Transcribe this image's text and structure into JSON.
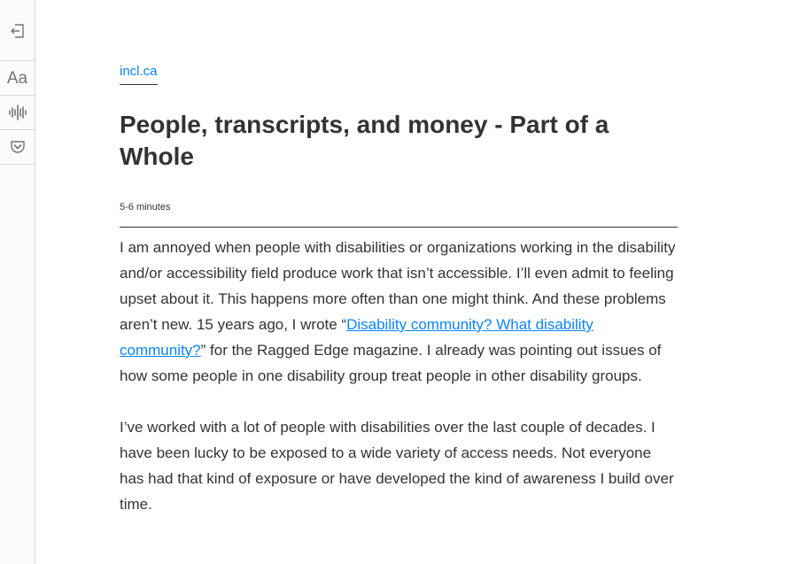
{
  "toolbar": {
    "buttons": [
      {
        "name": "close-reader-view-button",
        "icon": "exit-icon"
      },
      {
        "name": "type-controls-button",
        "icon": "type-aa-icon",
        "label": "Aa"
      },
      {
        "name": "narrate-button",
        "icon": "waveform-icon"
      },
      {
        "name": "save-to-pocket-button",
        "icon": "pocket-icon"
      }
    ]
  },
  "article": {
    "domain": "incl.ca",
    "title": "People, transcripts, and money - Part of a Whole",
    "reading_time": "5-6 minutes",
    "p1_before": "I am annoyed when people with disabilities or organizations working in the disability and/or accessibility field produce work that isn’t accessible. I’ll even admit to feeling upset about it. This happens more often than one might think. And these problems aren’t new. 15 years ago, I wrote “",
    "p1_link": "Disability community? What disability community?",
    "p1_after": "” for the Ragged Edge magazine. I already was pointing out issues of how some people in one disability group treat people in other disability groups.",
    "p2": "I’ve worked with a lot of people with disabilities over the last couple of decades. I have been lucky to be exposed to a wide variety of access needs. Not everyone has had that kind of exposure or have developed the kind of awareness I build over time."
  },
  "colors": {
    "link": "#0a84ff",
    "text": "#333333",
    "toolbar_bg": "#fbfbfb",
    "toolbar_icon": "#737373"
  }
}
